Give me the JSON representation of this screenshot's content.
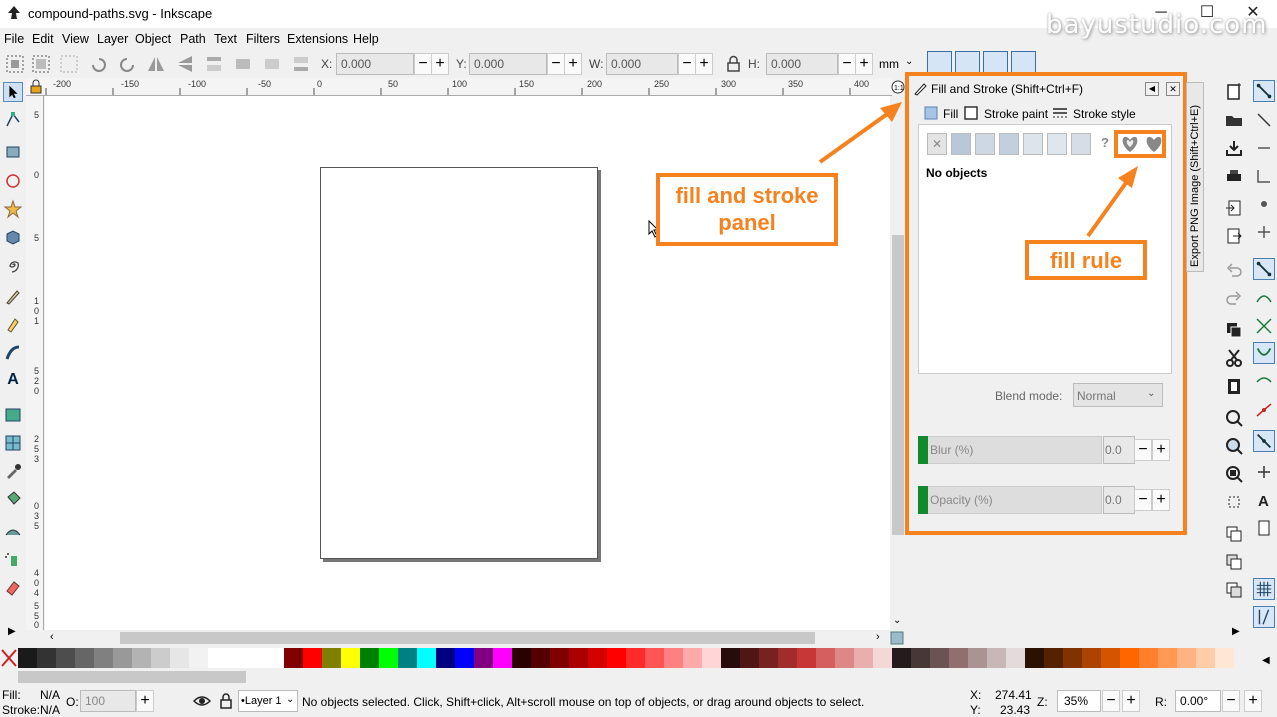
{
  "window": {
    "title": "compound-paths.svg - Inkscape",
    "minimize": "─",
    "maximize": "☐",
    "close": "✕"
  },
  "watermark": "bayustudio.com",
  "menu": [
    "File",
    "Edit",
    "View",
    "Layer",
    "Object",
    "Path",
    "Text",
    "Filters",
    "Extensions",
    "Help"
  ],
  "toolbar": {
    "x_label": "X:",
    "x_value": "0.000",
    "y_label": "Y:",
    "y_value": "0.000",
    "w_label": "W:",
    "w_value": "0.000",
    "h_label": "H:",
    "h_value": "0.000",
    "unit": "mm",
    "minus": "−",
    "plus": "+"
  },
  "ruler_top": [
    "-200",
    "-150",
    "-100",
    "-50",
    "0",
    "50",
    "100",
    "150",
    "200",
    "250",
    "300",
    "350",
    "400"
  ],
  "ruler_left": [
    "5",
    "0",
    "5",
    "1",
    "0",
    "1",
    "5",
    "2",
    "0",
    "2",
    "5",
    "3",
    "0",
    "3",
    "5",
    "4",
    "0",
    "4",
    "5",
    "5",
    "0"
  ],
  "panel": {
    "title": "Fill and Stroke (Shift+Ctrl+F)",
    "tabs": [
      "Fill",
      "Stroke paint",
      "Stroke style"
    ],
    "no_objects": "No objects",
    "blend_label": "Blend mode:",
    "blend_value": "Normal",
    "blur_label": "Blur (%)",
    "blur_value": "0.0",
    "opacity_label": "Opacity (%)",
    "opacity_value": "0.0",
    "side_tab": "Export PNG Image (Shift+Ctrl+E)"
  },
  "callouts": {
    "panel": "fill and stroke panel",
    "rule": "fill rule"
  },
  "palette": [
    "#1a1a1a",
    "#333333",
    "#4d4d4d",
    "#666666",
    "#808080",
    "#999999",
    "#b3b3b3",
    "#cccccc",
    "#e6e6e6",
    "#f2f2f2",
    "#ffffff",
    "#ffffff",
    "#ffffff",
    "#ffffff",
    "#800000",
    "#ff0000",
    "#808000",
    "#ffff00",
    "#008000",
    "#00ff00",
    "#008080",
    "#00ffff",
    "#000080",
    "#0000ff",
    "#800080",
    "#ff00ff",
    "#2b0000",
    "#550000",
    "#800000",
    "#aa0000",
    "#d40000",
    "#ff0000",
    "#ff2a2a",
    "#ff5555",
    "#ff8080",
    "#ffaaaa",
    "#ffd5d5",
    "#280b0b",
    "#501616",
    "#782121",
    "#a02c2c",
    "#c83737",
    "#d35f5f",
    "#de8787",
    "#e9afaf",
    "#f4d7d7",
    "#241c1c",
    "#483737",
    "#6c5353",
    "#916f6f",
    "#ac9393",
    "#c8b7b7",
    "#e3dbdb",
    "#2b1100",
    "#552200",
    "#803300",
    "#aa4400",
    "#d45500",
    "#ff6600",
    "#ff7f2a",
    "#ff9955",
    "#ffb380",
    "#ffccaa",
    "#ffe6d5"
  ],
  "status": {
    "fill_label": "Fill:",
    "fill_value": "N/A",
    "stroke_label": "Stroke:",
    "stroke_value": "N/A",
    "o_label": "O:",
    "o_value": "100",
    "layer": "•Layer 1",
    "message": "No objects selected. Click, Shift+click, Alt+scroll mouse on top of objects, or drag around objects to select.",
    "x_label": "X:",
    "x_value": "274.41",
    "y_label": "Y:",
    "y_value": "23.43",
    "z_label": "Z:",
    "zoom": "35%",
    "r_label": "R:",
    "rotation": "0.00°"
  },
  "colors": {
    "accent": "#f5811f",
    "panel_green": "#118a2e"
  }
}
